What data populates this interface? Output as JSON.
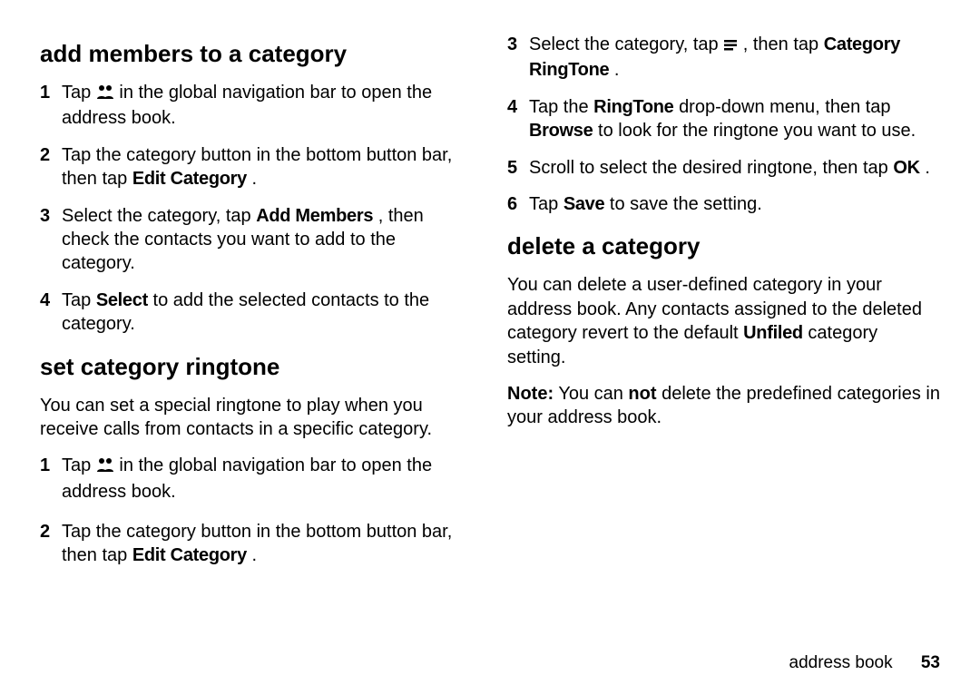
{
  "left": {
    "sec1": {
      "heading": "add members to a category",
      "steps": [
        {
          "n": "1",
          "pre": "Tap ",
          "icon": "contacts",
          "post": " in the global navigation bar to open the address book."
        },
        {
          "n": "2",
          "pre": "Tap the category button in the bottom button bar, then tap ",
          "b1": "Edit Category",
          "post": "."
        },
        {
          "n": "3",
          "pre": "Select the category, tap ",
          "b1": "Add Members",
          "post": ", then check the contacts you want to add to the category."
        },
        {
          "n": "4",
          "pre": "Tap ",
          "b1": "Select",
          "post": " to add the selected contacts to the category."
        }
      ]
    },
    "sec2": {
      "heading": "set category ringtone",
      "intro": "You can set a special ringtone to play when you receive calls from contacts in a specific category.",
      "steps": [
        {
          "n": "1",
          "pre": "Tap ",
          "icon": "contacts",
          "post": " in the global navigation bar to open the address book."
        }
      ]
    }
  },
  "right": {
    "stepsCont": [
      {
        "n": "2",
        "pre": "Tap the category button in the bottom button bar, then tap ",
        "b1": "Edit Category",
        "post": "."
      },
      {
        "n": "3",
        "pre": "Select the category, tap ",
        "icon": "menu",
        "mid": ", then tap ",
        "b1": "Category RingTone",
        "post": "."
      },
      {
        "n": "4",
        "pre": "Tap the ",
        "b1": "RingTone",
        "mid": " drop-down menu, then tap ",
        "b2": "Browse",
        "post": " to look for the ringtone you want to use."
      },
      {
        "n": "5",
        "pre": "Scroll to select the desired ringtone, then tap ",
        "b1": "OK",
        "post": "."
      },
      {
        "n": "6",
        "pre": "Tap ",
        "b1": "Save",
        "post": " to save the setting."
      }
    ],
    "sec3": {
      "heading": "delete a category",
      "p1_pre": "You can delete a user-defined category in your address book. Any contacts assigned to the deleted category revert to the default ",
      "p1_b": "Unfiled",
      "p1_post": " category setting.",
      "p2_b1": "Note:",
      "p2_mid": " You can ",
      "p2_b2": "not",
      "p2_post": " delete the predefined categories in your address book."
    }
  },
  "footer": {
    "section": "address book",
    "page": "53"
  }
}
